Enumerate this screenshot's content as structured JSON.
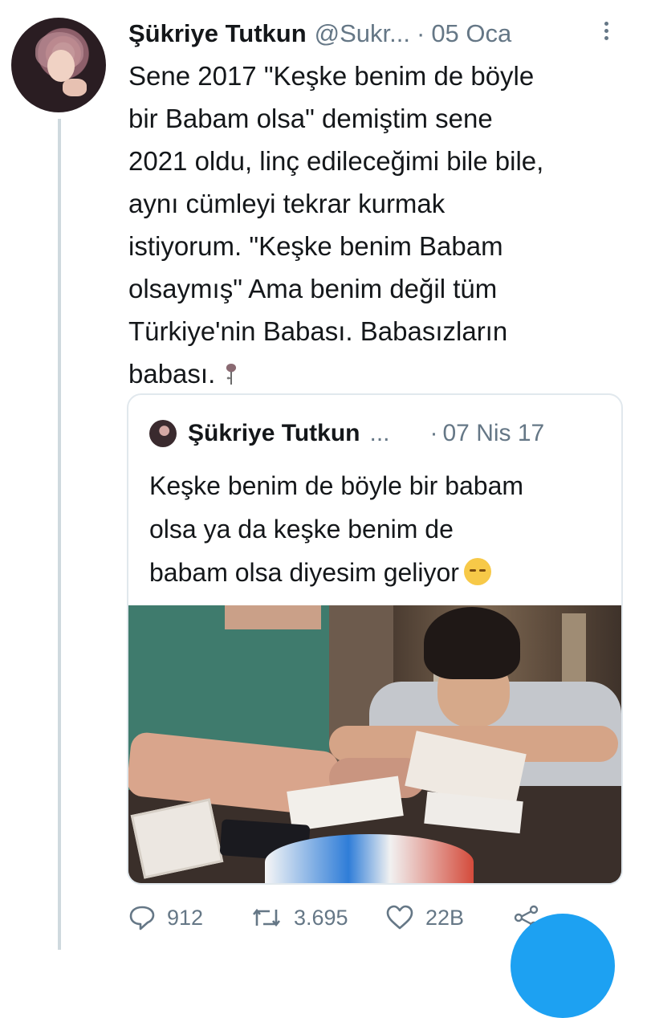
{
  "tweet": {
    "author_name": "Şükriye Tutkun",
    "handle": "@Sukr...",
    "separator": "·",
    "date": "05 Oca",
    "text": "Sene 2017 \"Keşke benim de böyle\nbir Babam olsa\" demiştim sene\n2021 oldu, linç edileceğimi bile bile,\naynı cümleyi tekrar kurmak\nistiyorum. \"Keşke benim Babam\nolsaymış\" Ama benim değil tüm\nTürkiye'nin Babası. Babasızların\nbabası.",
    "text_emoji": "rose-icon"
  },
  "quoted": {
    "author_name": "Şükriye Tutkun",
    "ellipsis": "...",
    "separator": "·",
    "date": "07 Nis 17",
    "text": "Keşke benim de böyle bir babam\nolsa ya da keşke benim de\nbabam olsa diyesim geliyor",
    "text_emoji": "pensive-face-emoji",
    "image": "photo-man-and-boy-at-table"
  },
  "actions": {
    "reply_count": "912",
    "retweet_count": "3.695",
    "like_count": "22B"
  },
  "colors": {
    "accent": "#1da1f2",
    "muted": "#657786",
    "text": "#14171a",
    "border": "#e1e8ed"
  }
}
